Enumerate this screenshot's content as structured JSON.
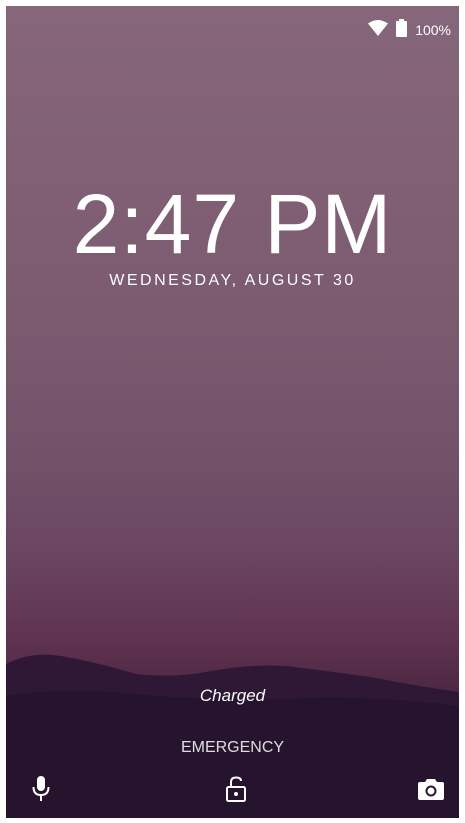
{
  "status_bar": {
    "wifi_icon": "wifi-icon",
    "battery_icon": "battery-icon",
    "battery_level": "100%"
  },
  "lock_screen": {
    "time": "2:47 PM",
    "date": "WEDNESDAY, AUGUST 30",
    "charging_status": "Charged",
    "emergency_label": "EMERGENCY"
  },
  "bottom_actions": {
    "left_icon": "microphone-icon",
    "center_icon": "unlock-icon",
    "right_icon": "camera-icon"
  },
  "colors": {
    "sky_top": "#86667a",
    "horizon": "#5f3350",
    "ground": "#21132a",
    "text": "#ffffff"
  }
}
